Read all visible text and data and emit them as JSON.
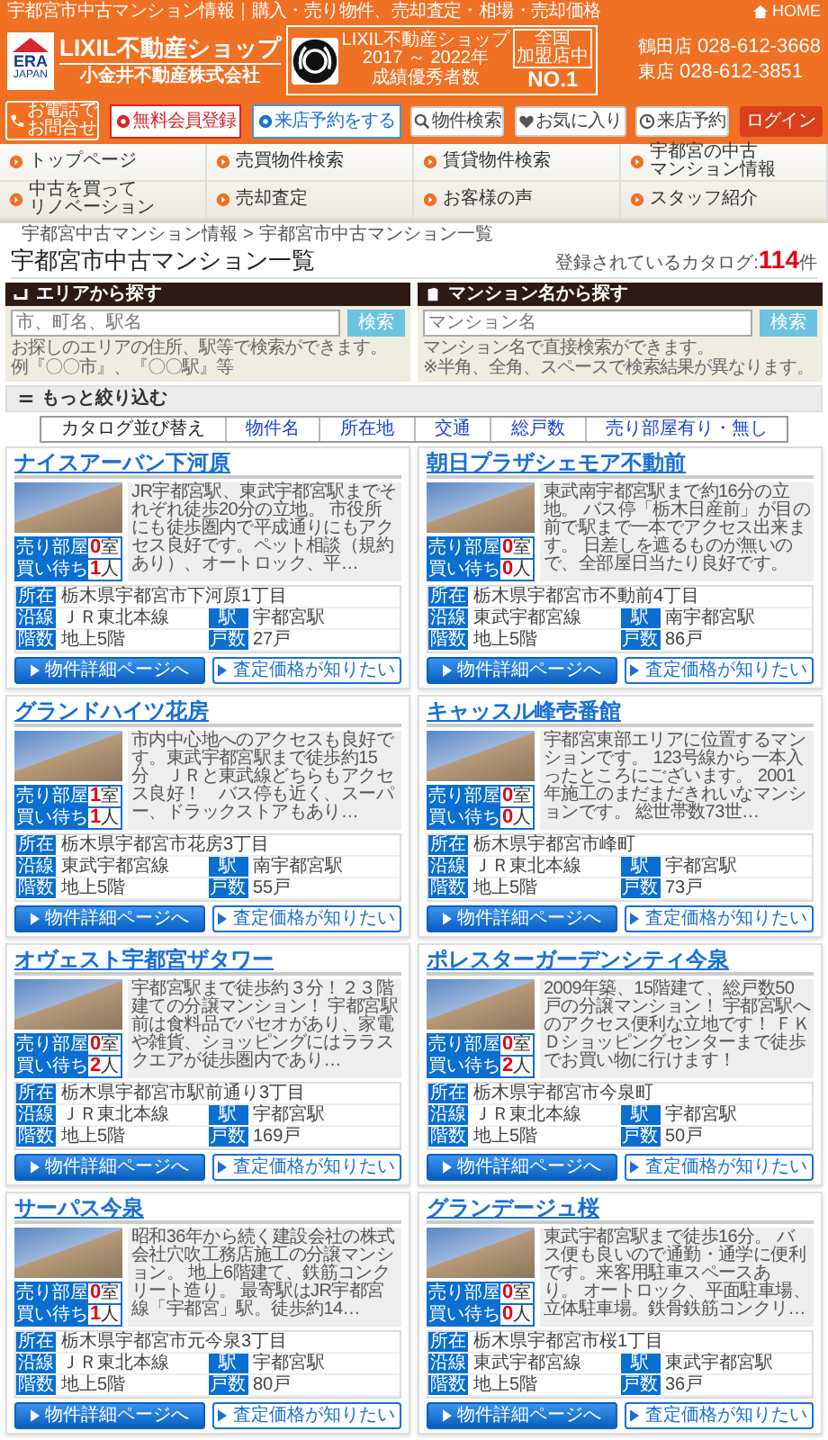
{
  "top_bar": {
    "tagline": "宇都宮市中古マンション情報｜購入・売り物件、売却査定・相場・売却価格",
    "home": "HOME"
  },
  "header": {
    "logo": {
      "mark": "ERA",
      "sub": "JAPAN"
    },
    "brand": "LIXIL不動産ショップ",
    "company": "小金井不動産株式会社",
    "award": {
      "text": [
        "LIXIL不動産ショップ",
        "2017 ～ 2022年",
        "成績優秀者数"
      ],
      "badge": [
        "全国",
        "加盟店中"
      ],
      "rank": "NO.1"
    },
    "phones": [
      {
        "store": "鶴田店",
        "number": "028-612-3668"
      },
      {
        "store": "東店",
        "number": "028-612-3851"
      }
    ],
    "contact": [
      "お電話で",
      "お問合せ"
    ],
    "actions": [
      {
        "label": "無料会員登録",
        "kind": "register"
      },
      {
        "label": "来店予約をする",
        "kind": "reserve"
      }
    ],
    "links": [
      {
        "label": "物件検索",
        "kind": "search"
      },
      {
        "label": "お気に入り",
        "kind": "favorite"
      },
      {
        "label": "来店予約",
        "kind": "reserve"
      },
      {
        "label": "ログイン",
        "kind": "login"
      }
    ]
  },
  "nav": [
    [
      "トップページ"
    ],
    [
      "売買物件検索"
    ],
    [
      "賃貸物件検索"
    ],
    [
      "宇都宮の中古",
      "マンション情報"
    ],
    [
      "中古を買って",
      "リノベーション"
    ],
    [
      "売却査定"
    ],
    [
      "お客様の声"
    ],
    [
      "スタッフ紹介"
    ]
  ],
  "breadcrumb": {
    "items": [
      "宇都宮中古マンション情報",
      "宇都宮市中古マンション一覧"
    ],
    "separator": ">"
  },
  "page_title": "宇都宮市中古マンション一覧",
  "catalog_count": {
    "label": "登録されているカタログ:",
    "count": "114",
    "unit": "件"
  },
  "search_boxes": [
    {
      "kind": "area",
      "title": "エリアから探す",
      "placeholder": "市、町名、駅名",
      "button": "検索",
      "help": [
        "お探しのエリアの住所、駅等で検索ができます。",
        "例『〇〇市』、『〇〇駅』等"
      ]
    },
    {
      "kind": "name",
      "title": "マンション名から探す",
      "placeholder": "マンション名",
      "button": "検索",
      "help": [
        "マンション名で直接検索ができます。",
        "※半角、全角、スペースで検索結果が異なります。"
      ]
    }
  ],
  "filter": {
    "label": "もっと絞り込む"
  },
  "sort": {
    "label": "カタログ並び替え",
    "options": [
      "物件名",
      "所在地",
      "交通",
      "総戸数",
      "売り部屋有り・無し"
    ]
  },
  "listings": [
    {
      "name": "ナイスアーバン下河原",
      "description": "JR宇都宮駅、東武宇都宮駅までそれぞれ徒歩20分の立地。 市役所にも徒歩圏内で平成通りにもアクセス良好です。ペット相談（規約あり）、オートロック、平…",
      "counts": [
        {
          "label": "売り部屋",
          "value": "0",
          "unit": "室"
        },
        {
          "label": "買い待ち",
          "value": "1",
          "unit": "人"
        }
      ],
      "info": [
        {
          "label": "所在",
          "value": "栃木県宇都宮市下河原1丁目"
        },
        {
          "label": "沿線",
          "value": "ＪＲ東北本線"
        },
        {
          "label": "駅",
          "value": "宇都宮駅"
        },
        {
          "label": "階数",
          "value": "地上5階"
        },
        {
          "label": "戸数",
          "value": "27戸"
        }
      ],
      "buttons": [
        {
          "label": "物件詳細ページへ",
          "kind": "primary"
        },
        {
          "label": "査定価格が知りたい",
          "kind": "secondary"
        }
      ]
    },
    {
      "name": "朝日プラザシェモア不動前",
      "description": "東武南宇都宮駅まで約16分の立地。 バス停「栃木日産前」が目の前で駅まで一本でアクセス出来ます。 日差しを遮るものが無いので、全部屋日当たり良好です。",
      "counts": [
        {
          "label": "売り部屋",
          "value": "0",
          "unit": "室"
        },
        {
          "label": "買い待ち",
          "value": "0",
          "unit": "人"
        }
      ],
      "info": [
        {
          "label": "所在",
          "value": "栃木県宇都宮市不動前4丁目"
        },
        {
          "label": "沿線",
          "value": "東武宇都宮線"
        },
        {
          "label": "駅",
          "value": "南宇都宮駅"
        },
        {
          "label": "階数",
          "value": "地上5階"
        },
        {
          "label": "戸数",
          "value": "86戸"
        }
      ],
      "buttons": [
        {
          "label": "物件詳細ページへ",
          "kind": "primary"
        },
        {
          "label": "査定価格が知りたい",
          "kind": "secondary"
        }
      ]
    },
    {
      "name": "グランドハイツ花房",
      "description": "市内中心地へのアクセスも良好です。東武宇都宮駅まで徒歩約15分　ＪＲと東武線どちらもアクセス良好！　バス停も近く、スーパー、ドラックストアもあり…",
      "counts": [
        {
          "label": "売り部屋",
          "value": "1",
          "unit": "室"
        },
        {
          "label": "買い待ち",
          "value": "1",
          "unit": "人"
        }
      ],
      "info": [
        {
          "label": "所在",
          "value": "栃木県宇都宮市花房3丁目"
        },
        {
          "label": "沿線",
          "value": "東武宇都宮線"
        },
        {
          "label": "駅",
          "value": "南宇都宮駅"
        },
        {
          "label": "階数",
          "value": "地上5階"
        },
        {
          "label": "戸数",
          "value": "55戸"
        }
      ],
      "buttons": [
        {
          "label": "物件詳細ページへ",
          "kind": "primary"
        },
        {
          "label": "査定価格が知りたい",
          "kind": "secondary"
        }
      ]
    },
    {
      "name": "キャッスル峰壱番館",
      "description": "宇都宮東部エリアに位置するマンションです。 123号線から一本入ったところにございます。 2001年施工のまだまだきれいなマンションです。 総世帯数73世…",
      "counts": [
        {
          "label": "売り部屋",
          "value": "0",
          "unit": "室"
        },
        {
          "label": "買い待ち",
          "value": "0",
          "unit": "人"
        }
      ],
      "info": [
        {
          "label": "所在",
          "value": "栃木県宇都宮市峰町"
        },
        {
          "label": "沿線",
          "value": "ＪＲ東北本線"
        },
        {
          "label": "駅",
          "value": "宇都宮駅"
        },
        {
          "label": "階数",
          "value": "地上5階"
        },
        {
          "label": "戸数",
          "value": "73戸"
        }
      ],
      "buttons": [
        {
          "label": "物件詳細ページへ",
          "kind": "primary"
        },
        {
          "label": "査定価格が知りたい",
          "kind": "secondary"
        }
      ]
    },
    {
      "name": "オヴェスト宇都宮ザタワー",
      "description": "宇都宮駅まで徒歩約３分！２３階建ての分譲マンション！ 宇都宮駅前は食料品でパセオがあり、家電や雑貨、ショッピングにはララスクエアが徒歩圏内であり…",
      "counts": [
        {
          "label": "売り部屋",
          "value": "0",
          "unit": "室"
        },
        {
          "label": "買い待ち",
          "value": "2",
          "unit": "人"
        }
      ],
      "info": [
        {
          "label": "所在",
          "value": "栃木県宇都宮市駅前通り3丁目"
        },
        {
          "label": "沿線",
          "value": "ＪＲ東北本線"
        },
        {
          "label": "駅",
          "value": "宇都宮駅"
        },
        {
          "label": "階数",
          "value": "地上5階"
        },
        {
          "label": "戸数",
          "value": "169戸"
        }
      ],
      "buttons": [
        {
          "label": "物件詳細ページへ",
          "kind": "primary"
        },
        {
          "label": "査定価格が知りたい",
          "kind": "secondary"
        }
      ]
    },
    {
      "name": "ポレスターガーデンシティ今泉",
      "description": "2009年築、15階建て、総戸数50戸の分譲マンション！ 宇都宮駅へのアクセス便利な立地です！ ＦＫＤショッピングセンターまで徒歩でお買い物に行けます！",
      "counts": [
        {
          "label": "売り部屋",
          "value": "0",
          "unit": "室"
        },
        {
          "label": "買い待ち",
          "value": "2",
          "unit": "人"
        }
      ],
      "info": [
        {
          "label": "所在",
          "value": "栃木県宇都宮市今泉町"
        },
        {
          "label": "沿線",
          "value": "ＪＲ東北本線"
        },
        {
          "label": "駅",
          "value": "宇都宮駅"
        },
        {
          "label": "階数",
          "value": "地上5階"
        },
        {
          "label": "戸数",
          "value": "50戸"
        }
      ],
      "buttons": [
        {
          "label": "物件詳細ページへ",
          "kind": "primary"
        },
        {
          "label": "査定価格が知りたい",
          "kind": "secondary"
        }
      ]
    },
    {
      "name": "サーパス今泉",
      "description": "昭和36年から続く建設会社の株式会社穴吹工務店施工の分譲マンション。 地上6階建て、鉄筋コンクリート造り。 最寄駅はJR宇都宮線「宇都宮」駅。徒歩約14…",
      "counts": [
        {
          "label": "売り部屋",
          "value": "0",
          "unit": "室"
        },
        {
          "label": "買い待ち",
          "value": "1",
          "unit": "人"
        }
      ],
      "info": [
        {
          "label": "所在",
          "value": "栃木県宇都宮市元今泉3丁目"
        },
        {
          "label": "沿線",
          "value": "ＪＲ東北本線"
        },
        {
          "label": "駅",
          "value": "宇都宮駅"
        },
        {
          "label": "階数",
          "value": "地上5階"
        },
        {
          "label": "戸数",
          "value": "80戸"
        }
      ],
      "buttons": [
        {
          "label": "物件詳細ページへ",
          "kind": "primary"
        },
        {
          "label": "査定価格が知りたい",
          "kind": "secondary"
        }
      ]
    },
    {
      "name": "グランデージュ桜",
      "description": "東武宇都宮駅まで徒歩16分。 バス便も良いので通勤・通学に便利です。来客用駐車スペースあり。 オートロック、平面駐車場、立体駐車場。鉄骨鉄筋コンクリ…",
      "counts": [
        {
          "label": "売り部屋",
          "value": "0",
          "unit": "室"
        },
        {
          "label": "買い待ち",
          "value": "0",
          "unit": "人"
        }
      ],
      "info": [
        {
          "label": "所在",
          "value": "栃木県宇都宮市桜1丁目"
        },
        {
          "label": "沿線",
          "value": "東武宇都宮線"
        },
        {
          "label": "駅",
          "value": "東武宇都宮駅"
        },
        {
          "label": "階数",
          "value": "地上5階"
        },
        {
          "label": "戸数",
          "value": "36戸"
        }
      ],
      "buttons": [
        {
          "label": "物件詳細ページへ",
          "kind": "primary"
        },
        {
          "label": "査定価格が知りたい",
          "kind": "secondary"
        }
      ]
    }
  ]
}
